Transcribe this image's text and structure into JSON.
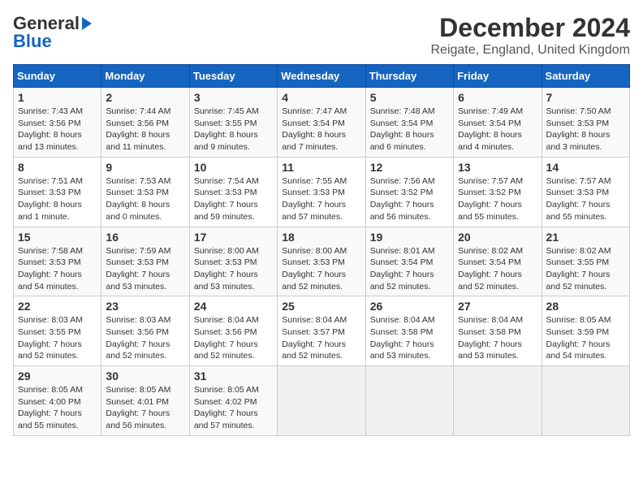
{
  "app": {
    "logo_general": "General",
    "logo_blue": "Blue"
  },
  "title": "December 2024",
  "subtitle": "Reigate, England, United Kingdom",
  "weekdays": [
    "Sunday",
    "Monday",
    "Tuesday",
    "Wednesday",
    "Thursday",
    "Friday",
    "Saturday"
  ],
  "weeks": [
    [
      {
        "day": 1,
        "sunrise": "7:43 AM",
        "sunset": "3:56 PM",
        "daylight": "8 hours and 13 minutes."
      },
      {
        "day": 2,
        "sunrise": "7:44 AM",
        "sunset": "3:56 PM",
        "daylight": "8 hours and 11 minutes."
      },
      {
        "day": 3,
        "sunrise": "7:45 AM",
        "sunset": "3:55 PM",
        "daylight": "8 hours and 9 minutes."
      },
      {
        "day": 4,
        "sunrise": "7:47 AM",
        "sunset": "3:54 PM",
        "daylight": "8 hours and 7 minutes."
      },
      {
        "day": 5,
        "sunrise": "7:48 AM",
        "sunset": "3:54 PM",
        "daylight": "8 hours and 6 minutes."
      },
      {
        "day": 6,
        "sunrise": "7:49 AM",
        "sunset": "3:54 PM",
        "daylight": "8 hours and 4 minutes."
      },
      {
        "day": 7,
        "sunrise": "7:50 AM",
        "sunset": "3:53 PM",
        "daylight": "8 hours and 3 minutes."
      }
    ],
    [
      {
        "day": 8,
        "sunrise": "7:51 AM",
        "sunset": "3:53 PM",
        "daylight": "8 hours and 1 minute."
      },
      {
        "day": 9,
        "sunrise": "7:53 AM",
        "sunset": "3:53 PM",
        "daylight": "8 hours and 0 minutes."
      },
      {
        "day": 10,
        "sunrise": "7:54 AM",
        "sunset": "3:53 PM",
        "daylight": "7 hours and 59 minutes."
      },
      {
        "day": 11,
        "sunrise": "7:55 AM",
        "sunset": "3:53 PM",
        "daylight": "7 hours and 57 minutes."
      },
      {
        "day": 12,
        "sunrise": "7:56 AM",
        "sunset": "3:52 PM",
        "daylight": "7 hours and 56 minutes."
      },
      {
        "day": 13,
        "sunrise": "7:57 AM",
        "sunset": "3:52 PM",
        "daylight": "7 hours and 55 minutes."
      },
      {
        "day": 14,
        "sunrise": "7:57 AM",
        "sunset": "3:53 PM",
        "daylight": "7 hours and 55 minutes."
      }
    ],
    [
      {
        "day": 15,
        "sunrise": "7:58 AM",
        "sunset": "3:53 PM",
        "daylight": "7 hours and 54 minutes."
      },
      {
        "day": 16,
        "sunrise": "7:59 AM",
        "sunset": "3:53 PM",
        "daylight": "7 hours and 53 minutes."
      },
      {
        "day": 17,
        "sunrise": "8:00 AM",
        "sunset": "3:53 PM",
        "daylight": "7 hours and 53 minutes."
      },
      {
        "day": 18,
        "sunrise": "8:00 AM",
        "sunset": "3:53 PM",
        "daylight": "7 hours and 52 minutes."
      },
      {
        "day": 19,
        "sunrise": "8:01 AM",
        "sunset": "3:54 PM",
        "daylight": "7 hours and 52 minutes."
      },
      {
        "day": 20,
        "sunrise": "8:02 AM",
        "sunset": "3:54 PM",
        "daylight": "7 hours and 52 minutes."
      },
      {
        "day": 21,
        "sunrise": "8:02 AM",
        "sunset": "3:55 PM",
        "daylight": "7 hours and 52 minutes."
      }
    ],
    [
      {
        "day": 22,
        "sunrise": "8:03 AM",
        "sunset": "3:55 PM",
        "daylight": "7 hours and 52 minutes."
      },
      {
        "day": 23,
        "sunrise": "8:03 AM",
        "sunset": "3:56 PM",
        "daylight": "7 hours and 52 minutes."
      },
      {
        "day": 24,
        "sunrise": "8:04 AM",
        "sunset": "3:56 PM",
        "daylight": "7 hours and 52 minutes."
      },
      {
        "day": 25,
        "sunrise": "8:04 AM",
        "sunset": "3:57 PM",
        "daylight": "7 hours and 52 minutes."
      },
      {
        "day": 26,
        "sunrise": "8:04 AM",
        "sunset": "3:58 PM",
        "daylight": "7 hours and 53 minutes."
      },
      {
        "day": 27,
        "sunrise": "8:04 AM",
        "sunset": "3:58 PM",
        "daylight": "7 hours and 53 minutes."
      },
      {
        "day": 28,
        "sunrise": "8:05 AM",
        "sunset": "3:59 PM",
        "daylight": "7 hours and 54 minutes."
      }
    ],
    [
      {
        "day": 29,
        "sunrise": "8:05 AM",
        "sunset": "4:00 PM",
        "daylight": "7 hours and 55 minutes."
      },
      {
        "day": 30,
        "sunrise": "8:05 AM",
        "sunset": "4:01 PM",
        "daylight": "7 hours and 56 minutes."
      },
      {
        "day": 31,
        "sunrise": "8:05 AM",
        "sunset": "4:02 PM",
        "daylight": "7 hours and 57 minutes."
      },
      null,
      null,
      null,
      null
    ]
  ]
}
